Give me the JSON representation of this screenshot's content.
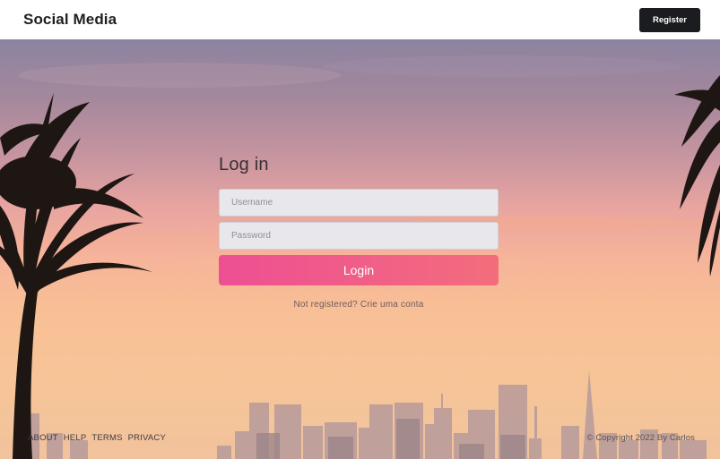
{
  "header": {
    "brand": "Social Media",
    "register_label": "Register"
  },
  "login": {
    "title": "Log in",
    "username_placeholder": "Username",
    "password_placeholder": "Password",
    "submit_label": "Login",
    "register_prompt": "Not registered? Crie uma conta"
  },
  "footer": {
    "links": [
      "ABOUT",
      "HELP",
      "TERMS",
      "PRIVACY"
    ],
    "copyright": "© Copyright 2022 By Carlos"
  },
  "icons": {
    "background": "city-skyline-palm-trees-illustration"
  },
  "colors": {
    "accent_start": "#ee4f92",
    "accent_end": "#f36d7c",
    "register_button": "#1b1c1f"
  }
}
